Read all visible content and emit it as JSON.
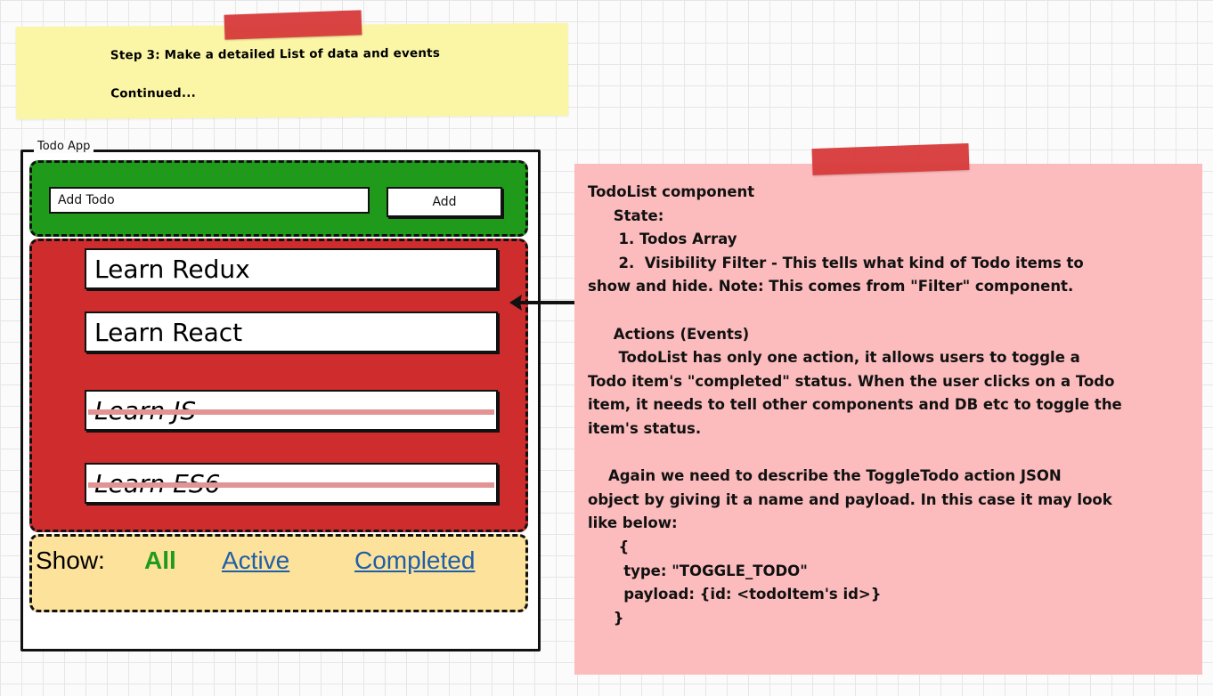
{
  "step_note": {
    "line1": "Step 3: Make a detailed List of data and events",
    "line2": "Continued..."
  },
  "app": {
    "title": "Todo App",
    "input_value": "Add Todo",
    "add_label": "Add",
    "todos": [
      {
        "text": "Learn Redux",
        "completed": false
      },
      {
        "text": "Learn React",
        "completed": false
      },
      {
        "text": "Learn JS",
        "completed": true
      },
      {
        "text": "Learn ES6",
        "completed": true
      }
    ],
    "filter": {
      "show_label": "Show:",
      "all": "All",
      "active": "Active",
      "completed": "Completed"
    },
    "colors": {
      "input_section": "#1f9a1b",
      "list_section": "#cf2c2e",
      "filter_section": "#fde29b",
      "active_filter": "#1f9a1b",
      "link": "#1f5fa8"
    }
  },
  "description_note": {
    "lines": [
      "TodoList component",
      "     State:",
      "      1. Todos Array",
      "      2.  Visibility Filter - This tells what kind of Todo items to",
      "show and hide. Note: This comes from \"Filter\" component.",
      "",
      "     Actions (Events)",
      "      TodoList has only one action, it allows users to toggle a",
      "Todo item's \"completed\" status. When the user clicks on a Todo",
      "item, it needs to tell other components and DB etc to toggle the",
      "item's status.",
      "",
      "    Again we need to describe the ToggleTodo action JSON",
      "object by giving it a name and payload. In this case it may look",
      "like below:",
      "      {",
      "       type: \"TOGGLE_TODO\"",
      "       payload: {id: <todoItem's id>}",
      "     }"
    ],
    "color": "#fcbbbd"
  }
}
